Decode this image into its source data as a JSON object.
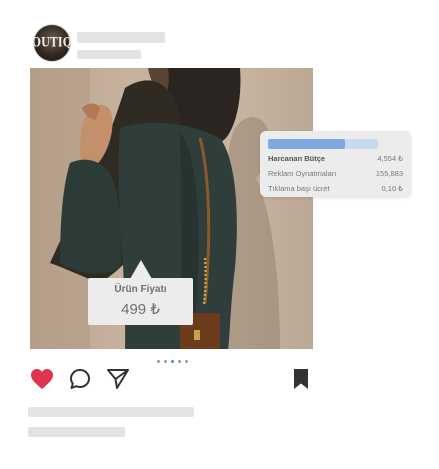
{
  "profile": {
    "avatar_text": "OUTIQ",
    "icon": "boutique-avatar"
  },
  "ad_stats": {
    "budget_spent_fraction": 0.7,
    "rows": [
      {
        "label": "Harcanan Bütçe",
        "value": "4,554 ₺"
      },
      {
        "label": "Reklam Oynatmaları",
        "value": "155,883"
      },
      {
        "label": "Tıklama başı ücret",
        "value": "0,10 ₺"
      }
    ]
  },
  "price_tag": {
    "label": "Ürün Fiyatı",
    "value": "499 ₺"
  },
  "carousel": {
    "page_count": 5,
    "active_index": 2
  },
  "actions": {
    "icons": [
      "heart-icon",
      "comment-icon",
      "share-icon",
      "bookmark-icon"
    ],
    "liked": true
  },
  "colors": {
    "like": "#e0334f",
    "icon": "#333333",
    "accent": "#3d8ee0",
    "budget_fill": "#7ea8e0",
    "budget_track": "#c9d9ef",
    "placeholder": "#e3e3e3"
  }
}
